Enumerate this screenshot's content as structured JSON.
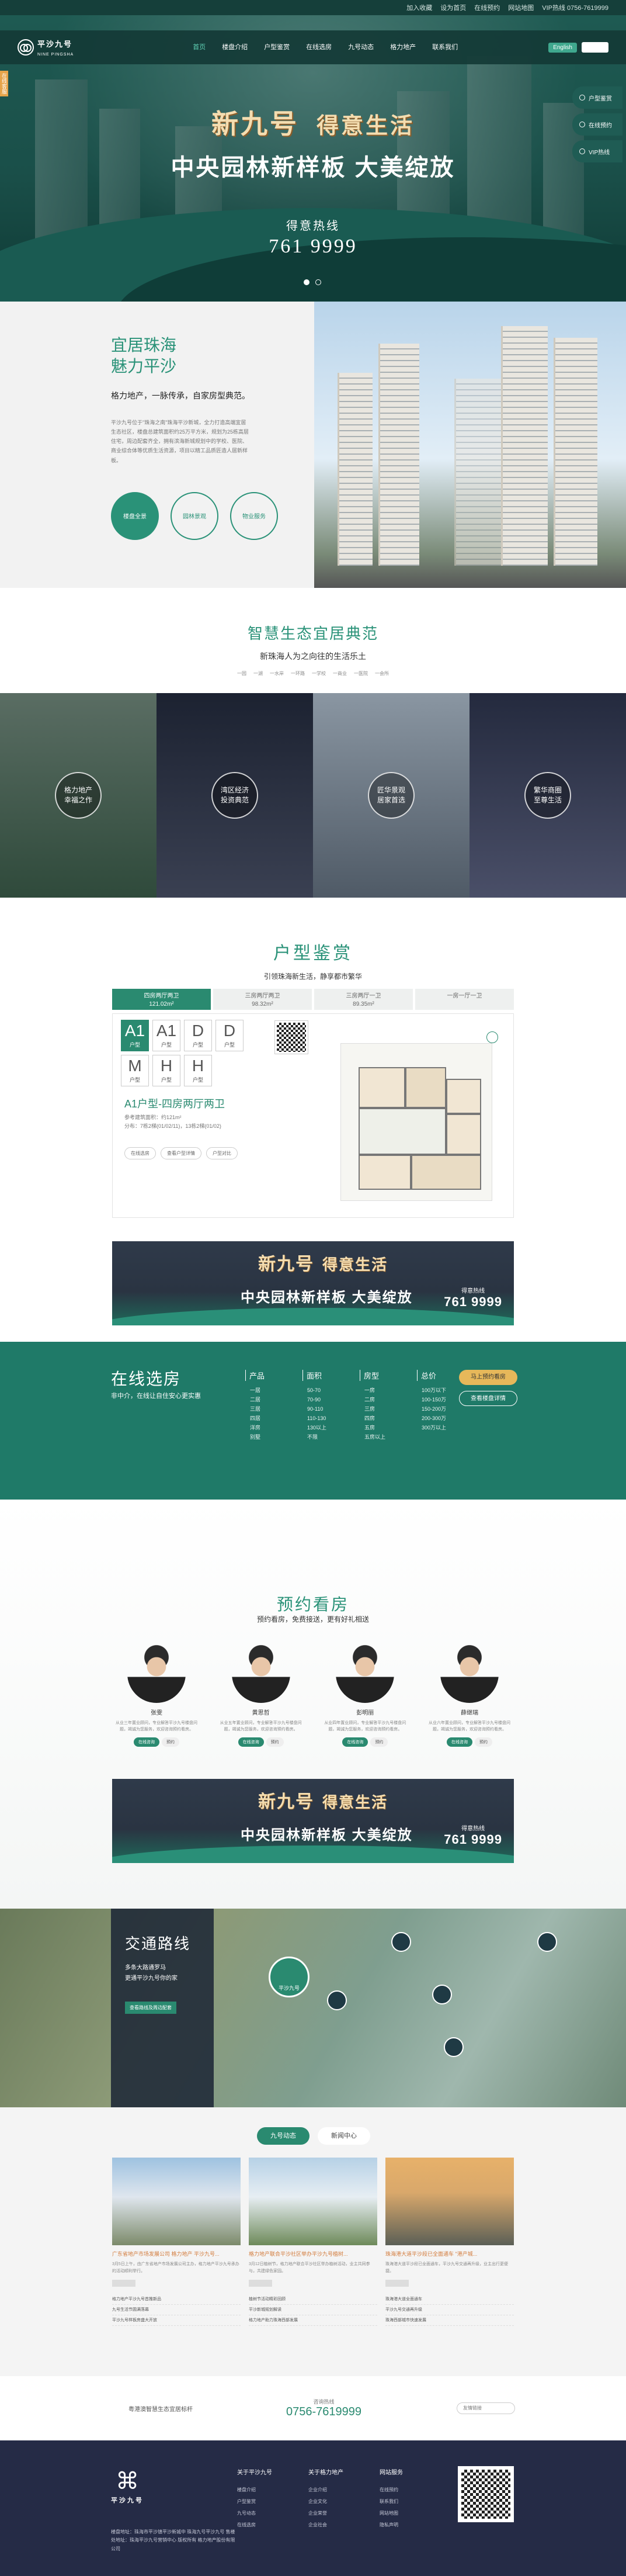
{
  "topbar": {
    "links": [
      "加入收藏",
      "设为首页",
      "在线预约",
      "网站地图"
    ],
    "vip": "VIP热线 0756-7619999"
  },
  "header": {
    "logo_cn": "平沙九号",
    "logo_en": "NINE PINGSHA",
    "nav": [
      "首页",
      "楼盘介绍",
      "户型鉴赏",
      "在线选房",
      "九号动态",
      "格力地产",
      "联系我们"
    ],
    "active_nav": 0,
    "lang": "English"
  },
  "hero": {
    "slogan_a": "新九号",
    "slogan_b": "得意生活",
    "slogan_c": "中央园林新样板  大美绽放",
    "hotline_label": "得意热线",
    "hotline_num": "761 9999"
  },
  "side_tabs": [
    "户型鉴赏",
    "在线预约",
    "VIP热线"
  ],
  "left_tab": "在线客服",
  "intro": {
    "title1": "宜居珠海",
    "title2": "魅力平沙",
    "sub": "格力地产，一脉传承，自家房型典范。",
    "body": "平沙九号位于\"珠海之南\"珠海平沙新城，全力打造高端宜居生态社区，楼盘总建筑面积约25万平方米，规划为25栋高层住宅，周边配套齐全，拥有滨海新城规划中的学校、医院、商业综合体等优质生活资源，项目以精工品质匠造人居新样板。",
    "buttons": [
      "楼盘全景",
      "园林景观",
      "物业服务"
    ]
  },
  "wisdom": {
    "title": "智慧生态宜居典范",
    "sub": "新珠海人为之向往的生活乐土",
    "tags": [
      "一园",
      "一湖",
      "一水岸",
      "一环路",
      "一学校",
      "一商业",
      "一医院",
      "一会所"
    ]
  },
  "features": [
    {
      "label": "格力地产\n幸福之作",
      "bg": "#3d5a4c"
    },
    {
      "label": "湾区经济\n投资典范",
      "bg": "#2a3140"
    },
    {
      "label": "匠华景观\n居家首选",
      "bg": "#6d7a86"
    },
    {
      "label": "繁华商圈\n至尊生活",
      "bg": "#333b52"
    }
  ],
  "houses": {
    "title": "户型鉴赏",
    "sub": "引领珠海新生活，静享都市繁华",
    "tabs": [
      {
        "t": "四房两厅两卫",
        "s": "121.02m²"
      },
      {
        "t": "三房两厅两卫",
        "s": "98.32m²"
      },
      {
        "t": "三房两厅一卫",
        "s": "89.35m²"
      },
      {
        "t": "一房一厅一卫",
        "s": ""
      }
    ],
    "letters": [
      {
        "l": "A1",
        "t": "户型"
      },
      {
        "l": "A1",
        "t": "户型"
      },
      {
        "l": "D",
        "t": "户型"
      },
      {
        "l": "D",
        "t": "户型"
      },
      {
        "l": "M",
        "t": "户型"
      },
      {
        "l": "H",
        "t": "户型"
      },
      {
        "l": "H",
        "t": "户型"
      }
    ],
    "type_name": "A1户型-四房两厅两卫",
    "info1": "参考建筑面积：约121m²",
    "info2": "分布：7栋2梯(01/02/11)，13栋2梯(01/02)",
    "tags": [
      "在线选房",
      "查看户型详情",
      "户型对比"
    ]
  },
  "banner": {
    "a": "新九号",
    "b": "得意生活",
    "c": "中央园林新样板  大美绽放",
    "hot_label": "得意热线",
    "hot_num": "761 9999"
  },
  "online": {
    "title": "在线选房",
    "sub": "非中介，在线让自住安心更实惠",
    "cols": [
      {
        "h": "产品",
        "items": [
          "一居",
          "二居",
          "三居",
          "四居",
          "洋房",
          "别墅"
        ]
      },
      {
        "h": "面积",
        "items": [
          "50-70",
          "70-90",
          "90-110",
          "110-130",
          "130以上",
          "不限"
        ]
      },
      {
        "h": "房型",
        "items": [
          "一房",
          "二房",
          "三房",
          "四房",
          "五房",
          "五房以上"
        ]
      },
      {
        "h": "总价",
        "items": [
          "100万以下",
          "100-150万",
          "150-200万",
          "200-300万",
          "300万以上"
        ]
      }
    ],
    "btn1": "马上预约看房",
    "btn2": "查看楼盘详情"
  },
  "appt": {
    "title": "预约看房",
    "sub": "预约看房，免费接送，更有好礼相送",
    "agents": [
      {
        "name": "张雯",
        "desc": "从业三年置业顾问，专业解答平沙九号楼盘问题，竭诚为您服务，欢迎咨询预约看房。"
      },
      {
        "name": "黄思哲",
        "desc": "从业五年置业顾问，专业解答平沙九号楼盘问题，竭诚为您服务，欢迎咨询预约看房。"
      },
      {
        "name": "彭明丽",
        "desc": "从业四年置业顾问，专业解答平沙九号楼盘问题，竭诚为您服务，欢迎咨询预约看房。"
      },
      {
        "name": "薛继瑞",
        "desc": "从业六年置业顾问，专业解答平沙九号楼盘问题，竭诚为您服务，欢迎咨询预约看房。"
      }
    ],
    "btn_a": "在线咨询",
    "btn_b": "预约"
  },
  "traffic": {
    "title": "交通路线",
    "p1": "多条大路通罗马",
    "p2": "更通平沙九号你的家",
    "btn": "查看路线及周边配套",
    "center": "平沙九号"
  },
  "news": {
    "tabs": [
      "九号动态",
      "新闻中心"
    ],
    "active_tab": 0,
    "cols": [
      {
        "h": "广东省地产市场发展公司 格力地产 平沙九号...",
        "p": "3月5日上午，由广东省地产市场发展公司主办，格力地产平沙九号承办的活动顺利举行。",
        "items": [
          "格力地产平沙九号首推新品",
          "九号生活节圆满落幕",
          "平沙九号样板房盛大开放"
        ]
      },
      {
        "h": "格力地产联合平沙社区举办平沙九号植树...",
        "p": "3月12日植树节，格力地产联合平沙社区举办植树活动，业主共同参与，共建绿色家园。",
        "items": [
          "植树节活动精彩回顾",
          "平沙新城规划解读",
          "格力地产助力珠海西部发展"
        ]
      },
      {
        "h": "珠海港大道平沙段已全面通车 \"港产城...",
        "p": "珠海港大道平沙段已全面通车，平沙九号交通再升级，业主出行更便捷。",
        "items": [
          "珠海港大道全面通车",
          "平沙九号交通再升级",
          "珠海西部城市快速发展"
        ]
      }
    ]
  },
  "contact": {
    "left": "粤港澳智慧生态宜居标杆",
    "label": "咨询热线",
    "num": "0756-7619999",
    "select": "友情链接"
  },
  "footer": {
    "logo": "平沙九号",
    "addr": "楼盘地址：珠海市平沙镇平沙新城中 珠海九号平沙九号 售楼处地址：珠海平沙九号营销中心 版权所有 格力地产股份有限公司",
    "cols": [
      {
        "h": "关于平沙九号",
        "items": [
          "楼盘介绍",
          "户型鉴赏",
          "九号动态",
          "在线选房"
        ]
      },
      {
        "h": "关于格力地产",
        "items": [
          "企业介绍",
          "企业文化",
          "企业荣誉",
          "企业社会"
        ]
      },
      {
        "h": "网站服务",
        "items": [
          "在线预约",
          "联系我们",
          "网站地图",
          "隐私声明"
        ]
      }
    ]
  }
}
